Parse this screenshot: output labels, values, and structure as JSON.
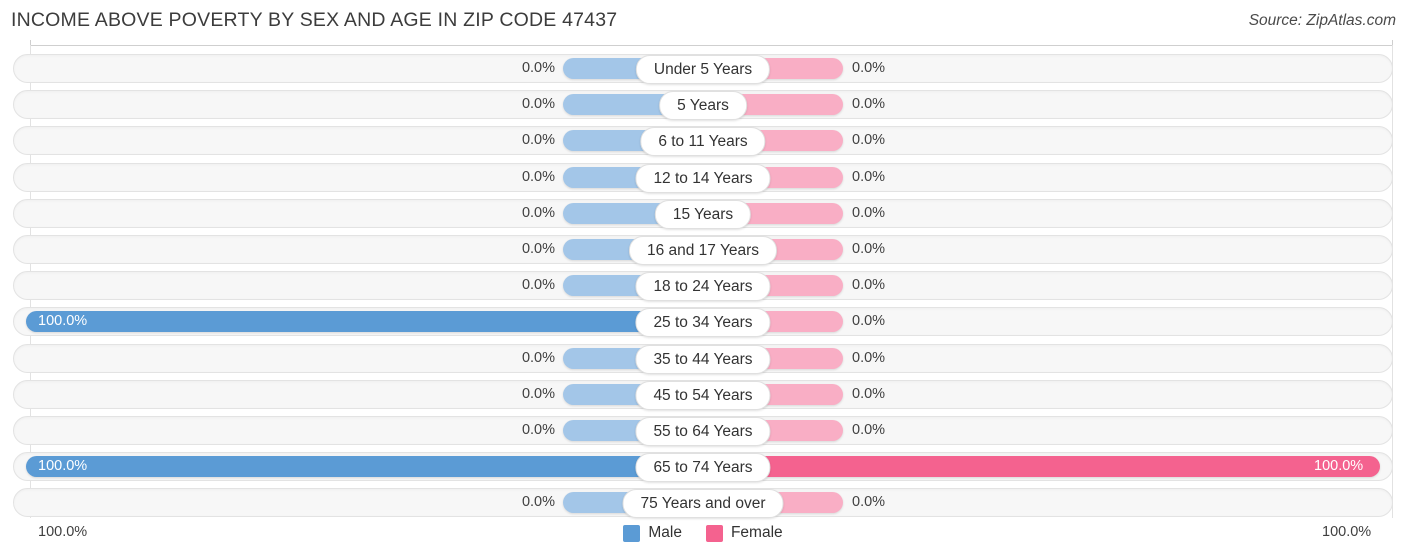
{
  "header": {
    "title": "INCOME ABOVE POVERTY BY SEX AND AGE IN ZIP CODE 47437",
    "source": "Source: ZipAtlas.com"
  },
  "legend": {
    "male_label": "Male",
    "female_label": "Female",
    "male_color": "#5b9bd5",
    "female_color": "#f4628f"
  },
  "axis": {
    "left_max_label": "100.0%",
    "right_max_label": "100.0%"
  },
  "chart_data": {
    "type": "bar",
    "orientation": "horizontal-diverging",
    "title": "INCOME ABOVE POVERTY BY SEX AND AGE IN ZIP CODE 47437",
    "xlabel": "",
    "ylabel": "",
    "xlim": [
      0,
      100
    ],
    "grid": false,
    "legend_position": "bottom-center",
    "categories": [
      "Under 5 Years",
      "5 Years",
      "6 to 11 Years",
      "12 to 14 Years",
      "15 Years",
      "16 and 17 Years",
      "18 to 24 Years",
      "25 to 34 Years",
      "35 to 44 Years",
      "45 to 54 Years",
      "55 to 64 Years",
      "65 to 74 Years",
      "75 Years and over"
    ],
    "series": [
      {
        "name": "Male",
        "values": [
          0.0,
          0.0,
          0.0,
          0.0,
          0.0,
          0.0,
          0.0,
          100.0,
          0.0,
          0.0,
          0.0,
          100.0,
          0.0
        ],
        "labels": [
          "0.0%",
          "0.0%",
          "0.0%",
          "0.0%",
          "0.0%",
          "0.0%",
          "0.0%",
          "100.0%",
          "0.0%",
          "0.0%",
          "0.0%",
          "100.0%",
          "0.0%"
        ]
      },
      {
        "name": "Female",
        "values": [
          0.0,
          0.0,
          0.0,
          0.0,
          0.0,
          0.0,
          0.0,
          0.0,
          0.0,
          0.0,
          0.0,
          100.0,
          0.0
        ],
        "labels": [
          "0.0%",
          "0.0%",
          "0.0%",
          "0.0%",
          "0.0%",
          "0.0%",
          "0.0%",
          "0.0%",
          "0.0%",
          "0.0%",
          "0.0%",
          "100.0%",
          "0.0%"
        ]
      }
    ]
  },
  "rows": [
    {
      "label": "Under 5 Years",
      "male": "0.0%",
      "female": "0.0%",
      "male_full": false,
      "female_full": false
    },
    {
      "label": "5 Years",
      "male": "0.0%",
      "female": "0.0%",
      "male_full": false,
      "female_full": false
    },
    {
      "label": "6 to 11 Years",
      "male": "0.0%",
      "female": "0.0%",
      "male_full": false,
      "female_full": false
    },
    {
      "label": "12 to 14 Years",
      "male": "0.0%",
      "female": "0.0%",
      "male_full": false,
      "female_full": false
    },
    {
      "label": "15 Years",
      "male": "0.0%",
      "female": "0.0%",
      "male_full": false,
      "female_full": false
    },
    {
      "label": "16 and 17 Years",
      "male": "0.0%",
      "female": "0.0%",
      "male_full": false,
      "female_full": false
    },
    {
      "label": "18 to 24 Years",
      "male": "0.0%",
      "female": "0.0%",
      "male_full": false,
      "female_full": false
    },
    {
      "label": "25 to 34 Years",
      "male": "100.0%",
      "female": "0.0%",
      "male_full": true,
      "female_full": false
    },
    {
      "label": "35 to 44 Years",
      "male": "0.0%",
      "female": "0.0%",
      "male_full": false,
      "female_full": false
    },
    {
      "label": "45 to 54 Years",
      "male": "0.0%",
      "female": "0.0%",
      "male_full": false,
      "female_full": false
    },
    {
      "label": "55 to 64 Years",
      "male": "0.0%",
      "female": "0.0%",
      "male_full": false,
      "female_full": false
    },
    {
      "label": "65 to 74 Years",
      "male": "100.0%",
      "female": "100.0%",
      "male_full": true,
      "female_full": true
    },
    {
      "label": "75 Years and over",
      "male": "0.0%",
      "female": "0.0%",
      "male_full": false,
      "female_full": false
    }
  ]
}
